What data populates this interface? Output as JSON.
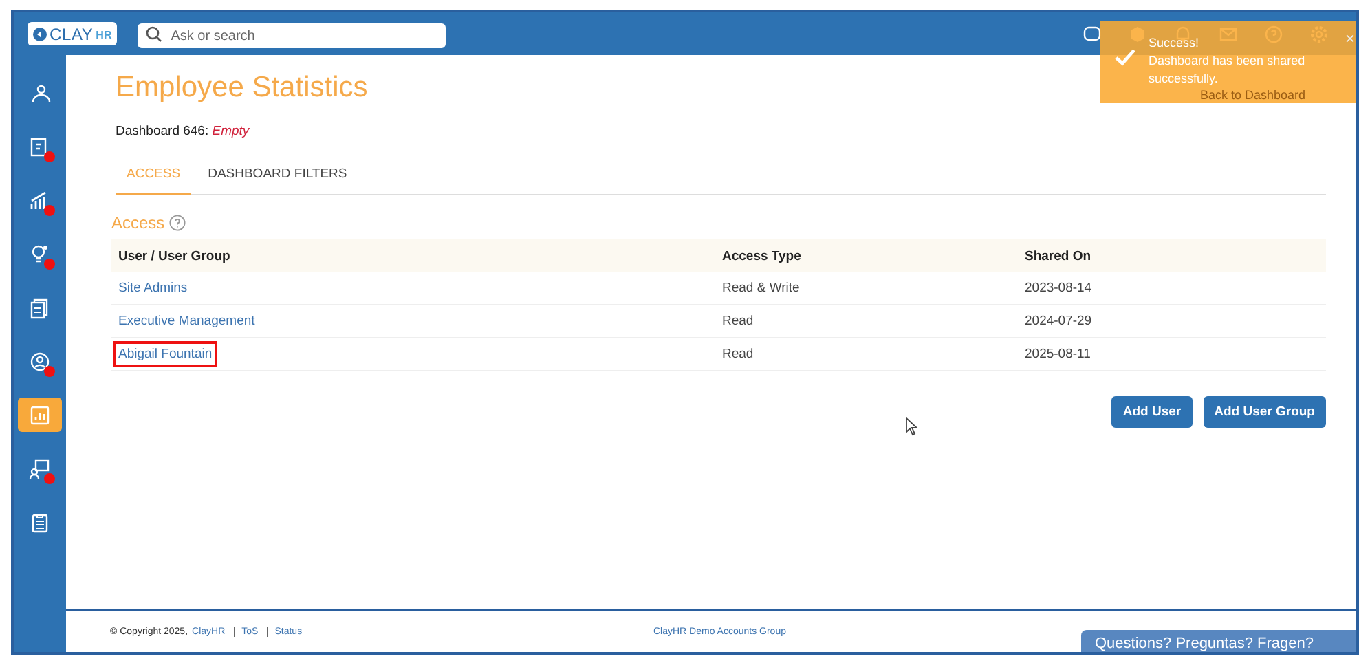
{
  "header": {
    "logo": {
      "main": "CLAY",
      "sub": "HR"
    },
    "search": {
      "placeholder": "Ask or search"
    }
  },
  "sidebar": {
    "items": [
      {
        "kind": "people",
        "selected": false,
        "alert": false
      },
      {
        "kind": "payslip",
        "selected": false,
        "alert": true
      },
      {
        "kind": "growth",
        "selected": false,
        "alert": true
      },
      {
        "kind": "bulb",
        "selected": false,
        "alert": true
      },
      {
        "kind": "docs",
        "selected": false,
        "alert": false
      },
      {
        "kind": "person",
        "selected": false,
        "alert": true
      },
      {
        "kind": "report",
        "selected": true,
        "alert": false
      },
      {
        "kind": "learning",
        "selected": false,
        "alert": true
      },
      {
        "kind": "clipboard",
        "selected": false,
        "alert": false
      }
    ]
  },
  "page": {
    "title": "Employee Statistics",
    "subtitle_label": "Dashboard 646:",
    "subtitle_value": "Empty",
    "back_link": "Back to Dashboard"
  },
  "tabs": [
    {
      "label": "ACCESS",
      "selected": true
    },
    {
      "label": "DASHBOARD FILTERS",
      "selected": false
    }
  ],
  "section": {
    "title": "Access"
  },
  "table": {
    "columns": [
      "User / User Group",
      "Access Type",
      "Shared On"
    ],
    "rows": [
      {
        "name": "Site Admins",
        "access": "Read & Write",
        "shared_on": "2023-08-14",
        "highlighted": false
      },
      {
        "name": "Executive Management",
        "access": "Read",
        "shared_on": "2024-07-29",
        "highlighted": false
      },
      {
        "name": "Abigail Fountain",
        "access": "Read",
        "shared_on": "2025-08-11",
        "highlighted": true
      }
    ]
  },
  "buttons": [
    "Add User",
    "Add User Group"
  ],
  "toast": {
    "title": "Success!",
    "message": "Dashboard has been shared successfully.",
    "close": "×"
  },
  "footer": {
    "copyright": "© Copyright 2025,",
    "company": "ClayHR",
    "links": [
      "ToS",
      "Status"
    ],
    "center": "ClayHR Demo Accounts Group"
  },
  "chat_tab": {
    "label": "Questions? Preguntas? Fragen?"
  }
}
